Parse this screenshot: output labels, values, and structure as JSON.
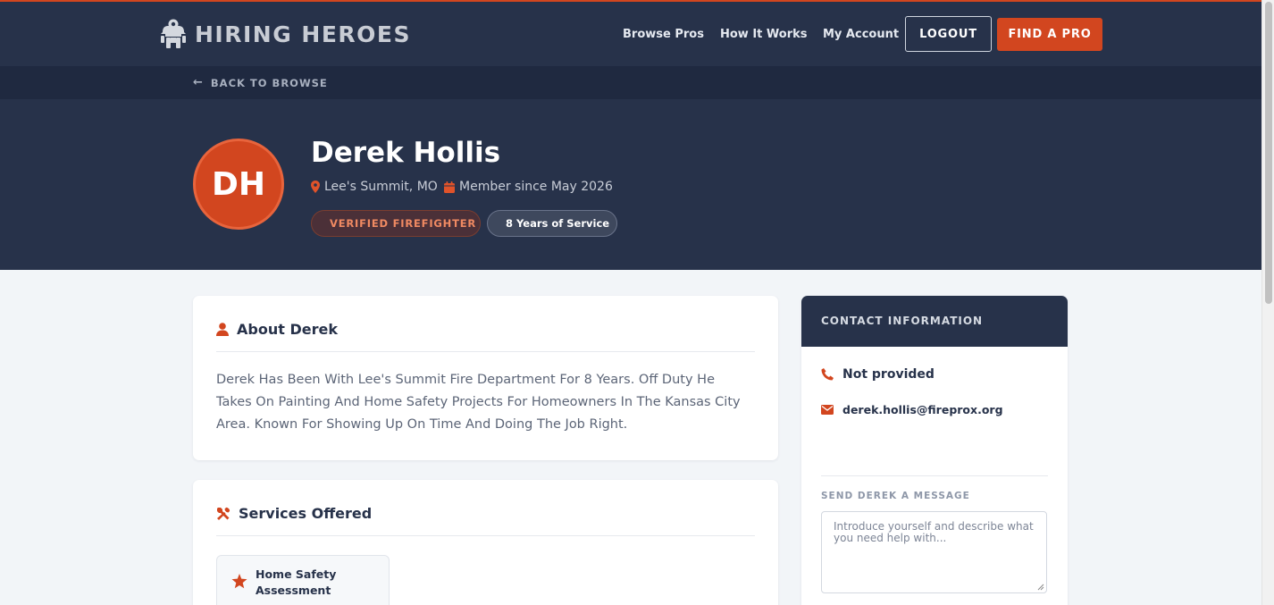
{
  "brand": {
    "name": "HIRING HEROES",
    "accent_color": "#d2461f",
    "nav_bg": "#27324a"
  },
  "nav": {
    "links": [
      "Browse Pros",
      "How It Works",
      "My Account"
    ],
    "logout_label": "LOGOUT",
    "find_label": "FIND A PRO"
  },
  "subbar": {
    "back_label": "BACK TO BROWSE",
    "back_icon": "arrow-left-icon"
  },
  "profile": {
    "initials": "DH",
    "name": "Derek Hollis",
    "location": "Lee's Summit, MO",
    "member_since": "Member since May 2026",
    "badges": {
      "verified": "VERIFIED FIREFIGHTER",
      "years": "8 Years of Service"
    }
  },
  "about": {
    "title": "About Derek",
    "icon": "user-icon",
    "text": "Derek Has Been With Lee's Summit Fire Department For 8 Years. Off Duty He Takes On Painting And Home Safety Projects For Homeowners In The Kansas City Area. Known For Showing Up On Time And Doing The Job Right."
  },
  "services": {
    "title": "Services Offered",
    "icon": "tools-icon",
    "items": [
      {
        "label": "Home Safety Assessment",
        "icon": "star-icon"
      }
    ]
  },
  "contact": {
    "title": "CONTACT INFORMATION",
    "phone": "Not provided",
    "email": "derek.hollis@fireprox.org",
    "message_label": "SEND DEREK A MESSAGE",
    "message_placeholder": "Introduce yourself and describe what you need help with..."
  }
}
